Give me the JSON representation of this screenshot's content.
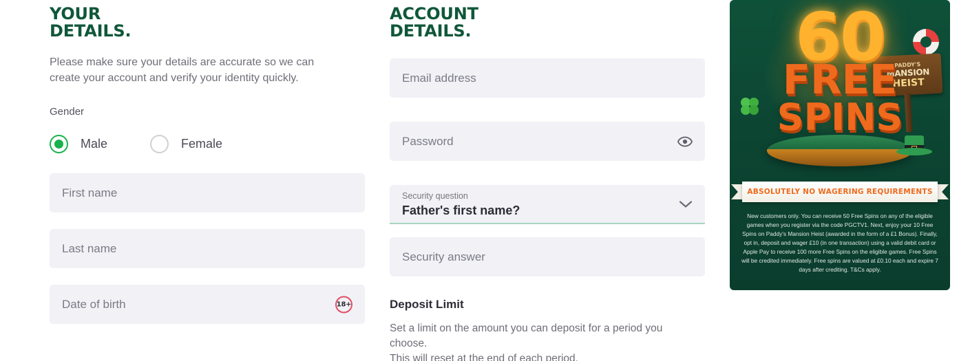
{
  "your_details": {
    "title_line1": "YOUR",
    "title_line2": "DETAILS.",
    "intro": "Please make sure your details are accurate so we can create your account and verify your identity quickly.",
    "gender_label": "Gender",
    "gender_options": [
      {
        "label": "Male",
        "selected": true
      },
      {
        "label": "Female",
        "selected": false
      }
    ],
    "fields": [
      {
        "placeholder": "First name",
        "value": "",
        "icon": ""
      },
      {
        "placeholder": "Last name",
        "value": "",
        "icon": ""
      },
      {
        "placeholder": "Date of birth",
        "value": "",
        "icon": "18-plus-badge"
      }
    ],
    "age_badge": "18+"
  },
  "account_details": {
    "title_line1": "ACCOUNT",
    "title_line2": "DETAILS.",
    "email": {
      "placeholder": "Email address",
      "value": ""
    },
    "password": {
      "placeholder": "Password",
      "value": "",
      "icon": "eye-icon"
    },
    "security_question": {
      "label": "Security question",
      "selected": "Father's first name?",
      "icon": "chevron-down-icon"
    },
    "security_answer": {
      "placeholder": "Security answer",
      "value": ""
    },
    "deposit_limit": {
      "heading": "Deposit Limit",
      "text_line1": "Set a limit on the amount you can deposit for a period you choose.",
      "text_line2": "This will reset at the end of each period."
    }
  },
  "promo": {
    "amount": "60",
    "free": "FREE",
    "spins": "SPINS",
    "game_sign": {
      "line1": "PADDY'S",
      "line2": "MANSION",
      "line3": "HEIST"
    },
    "ribbon": "ABSOLUTELY NO WAGERING REQUIREMENTS",
    "terms": "New customers only. You can receive 50 Free Spins on any of the eligible games when you register via the code PGCTV1. Next, enjoy your 10 Free Spins on Paddy's Mansion Heist (awarded in the form of a £1 Bonus). Finally, opt in, deposit and wager £10 (in one transaction) using a valid debit card or Apple Pay to receive 100 more Free Spins on the eligible games. Free Spins will be credited immediately. Free spins are valued at £0.10 each and expire 7 days after crediting. T&Cs apply."
  },
  "colors": {
    "heading_green": "#10573a",
    "radio_green": "#17b24c",
    "input_bg": "#f1f1f6",
    "promo_bg": "#0d4a34",
    "promo_orange": "#ef6a1d",
    "promo_gold": "#ffb22e",
    "badge_red": "#e34f63",
    "underline_green": "#a9d6bf"
  }
}
